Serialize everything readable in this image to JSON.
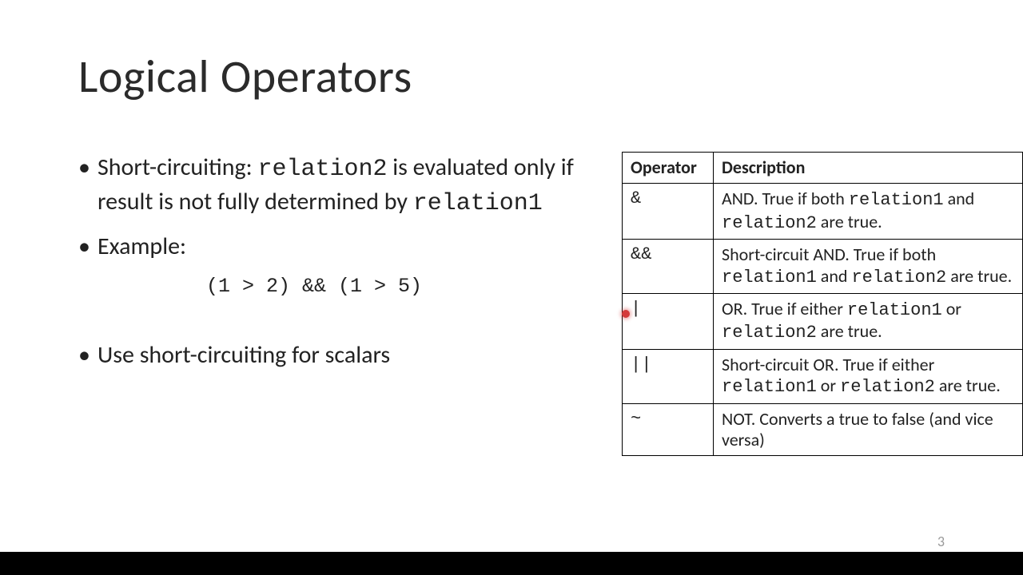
{
  "slide": {
    "title": "Logical Operators",
    "page_number": "3",
    "bullets": {
      "b1_pre": "Short-circuiting: ",
      "b1_code": "relation2",
      "b1_mid": " is evaluated only if result is not fully determined by ",
      "b1_code2": "relation1",
      "b2": "Example:",
      "example_code": "(1 > 2) && (1 > 5)",
      "b3": "Use short-circuiting for scalars"
    },
    "table": {
      "headers": {
        "op": "Operator",
        "desc": "Description"
      },
      "rows": [
        {
          "op": "&",
          "d0": "AND. True if both ",
          "d1": "relation1",
          "d2": " and ",
          "d3": "relation2",
          "d4": " are true."
        },
        {
          "op": "&&",
          "d0": "Short-circuit AND. True if both ",
          "d1": "relation1",
          "d2": " and ",
          "d3": "relation2",
          "d4": "  are true."
        },
        {
          "op": "|",
          "d0": "OR. True if either ",
          "d1": "relation1",
          "d2": " or ",
          "d3": "relation2",
          "d4": " are true."
        },
        {
          "op": "||",
          "d0": "Short-circuit OR. True if either ",
          "d1": "relation1",
          "d2": " or ",
          "d3": "relation2",
          "d4": " are true."
        },
        {
          "op": "~",
          "d0": "NOT. Converts a true to false (and vice versa)",
          "d1": "",
          "d2": "",
          "d3": "",
          "d4": ""
        }
      ]
    }
  }
}
